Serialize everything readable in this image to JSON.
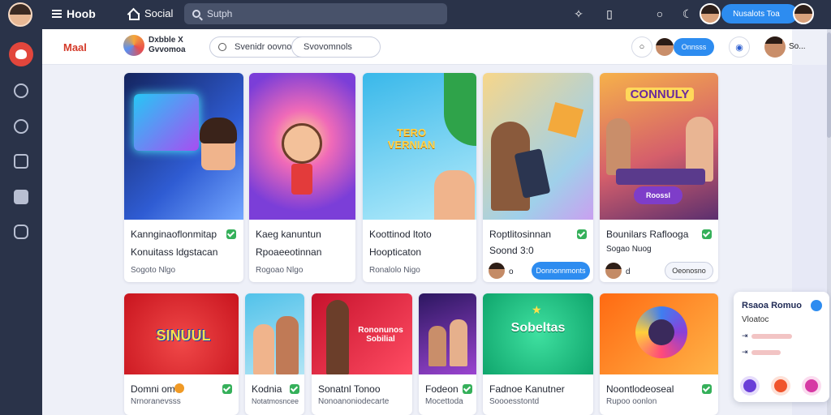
{
  "topbar": {
    "brand": "Hoob",
    "nav_social": "Social",
    "search_placeholder": "Sutph",
    "action_pill": "Nusalots Toa"
  },
  "subheader": {
    "title": "Maal",
    "brand_line1": "Dxbble X",
    "brand_line2": "Gvvomoa",
    "filter1": "Svenidr oovnos",
    "filter2": "Svovomnols",
    "blue_pill": "Onnsss",
    "user_label": "So..."
  },
  "cards_row1": [
    {
      "title": "Kannginaoflonmitap",
      "subtitle": "Konuitass ldgstacan",
      "meta": "Sogoto Nlgo",
      "art_text": "",
      "colors": [
        "#1b2c6b",
        "#3b66d6"
      ]
    },
    {
      "title": "Kaeg kanuntun",
      "subtitle": "Rpoaeeotinnan",
      "meta": "Rogoao Nlgo",
      "art_text": "",
      "colors": [
        "#7b3ed8",
        "#f07ac2"
      ]
    },
    {
      "title": "Koottinod ltoto",
      "subtitle": "Hoopticaton",
      "meta": "Ronalolo Nigo",
      "art_text": "TERO VERNIAN",
      "colors": [
        "#4fc8f0",
        "#9be2f7"
      ]
    },
    {
      "title": "Roptlitosinnan",
      "subtitle": "Soond 3:0",
      "meta": "",
      "button": "Donnonnmonts",
      "art_text": "",
      "colors": [
        "#f5c76a",
        "#69b9e3"
      ]
    },
    {
      "title": "Bounilars Raflooga",
      "subtitle": "Sogao Nuog",
      "meta": "",
      "art_text": "CONNULY",
      "art_button": "Roossl",
      "button": "Oeonosno",
      "colors": [
        "#f3a33e",
        "#c2467a"
      ]
    }
  ],
  "cards_row2": [
    {
      "title": "Domni om",
      "meta": "Nrnoranevsss",
      "art_text": "SINUUL",
      "colors": [
        "#e0262d",
        "#f0464a"
      ]
    },
    {
      "title": "Kodnia",
      "meta": "Notatmosncee",
      "art_text": "",
      "colors": [
        "#5ec6ec",
        "#a8e0f3"
      ]
    },
    {
      "title": "Sonatnl Tonoo",
      "meta": "Nonoanoniodecarte",
      "art_text": "Rononunos Sobilial",
      "colors": [
        "#ea1f3c",
        "#ff5a6e"
      ]
    },
    {
      "title": "Fodeon",
      "meta": "Mocettoda",
      "art_text": "",
      "colors": [
        "#3b1f6c",
        "#8a3fc8"
      ]
    },
    {
      "title": "Fadnoe Kanutner",
      "meta": "Soooesstontd",
      "art_text": "Sobeltas",
      "colors": [
        "#13b97b",
        "#3fd89c"
      ]
    },
    {
      "title": "Noontlodeoseal",
      "meta": "Rupoo oonlon",
      "art_text": "",
      "colors": [
        "#ff7a1a",
        "#ffb347"
      ]
    }
  ],
  "panel": {
    "title": "Rsaoa Romuo",
    "subtitle": "Vloatoc",
    "rows": [
      "⇥",
      "⇥"
    ]
  }
}
